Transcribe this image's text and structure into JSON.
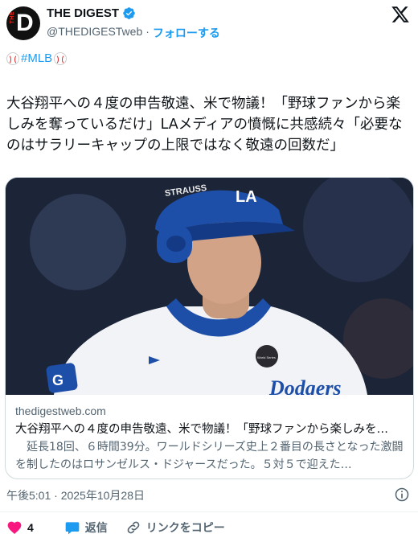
{
  "account": {
    "display_name": "THE DIGEST",
    "handle": "@THEDIGESTweb",
    "separator": "·",
    "follow_label": "フォローする",
    "avatar_letter": "D",
    "avatar_small_text": "THE"
  },
  "hashtag": "#MLB",
  "tweet_text": "大谷翔平への４度の申告敬遠、米で物議！「野球ファンから楽しみを奪っているだけ」LAメディアの憤慨に共感続々「必要なのはサラリーキャップの上限ではなく敬遠の回数だ」",
  "card": {
    "domain": "thedigestweb.com",
    "title": "大谷翔平への４度の申告敬遠、米で物議！「野球ファンから楽しみを…",
    "description": "　延長18回、６時間39分。ワールドシリーズ史上２番目の長さとなった激闘を制したのはロサンゼルス・ドジャースだった。５対５で迎えた…",
    "image": {
      "helmet_text": "STRAUSS",
      "helmet_logo": "LA",
      "jersey_patch": "G",
      "sleeve_patch": "World Series",
      "jersey_text": "Dodgers"
    }
  },
  "timestamp": "午後5:01 · 2025年10月28日",
  "actions": {
    "like_count": "4",
    "reply_label": "返信",
    "copy_link_label": "リンクをコピー"
  },
  "colors": {
    "accent": "#1d9bf0",
    "like": "#f91880",
    "verified": "#1d9bf0",
    "dodger_blue": "#1e4fa8"
  }
}
